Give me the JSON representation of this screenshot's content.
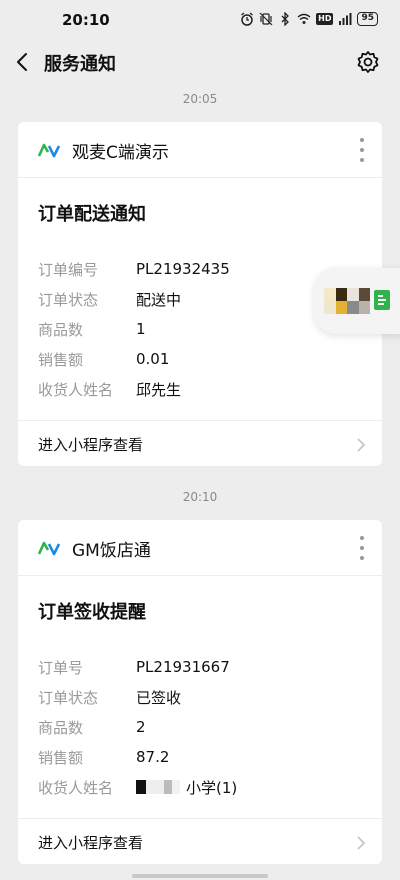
{
  "status_bar": {
    "time": "20:10",
    "battery": "95",
    "icons": [
      "alarm-icon",
      "vibrate-icon",
      "bluetooth-icon",
      "wifi-icon",
      "hd-icon",
      "signal-icon",
      "battery-icon"
    ],
    "hd_label": "HD"
  },
  "nav": {
    "title": "服务通知"
  },
  "messages": [
    {
      "timestamp": "20:05",
      "app_name": "观麦C端演示",
      "title": "订单配送通知",
      "fields": [
        {
          "label": "订单编号",
          "value": "PL21932435"
        },
        {
          "label": "订单状态",
          "value": "配送中"
        },
        {
          "label": "商品数",
          "value": "1"
        },
        {
          "label": "销售额",
          "value": "0.01"
        },
        {
          "label": "收货人姓名",
          "value": "邱先生"
        }
      ],
      "footer": "进入小程序查看"
    },
    {
      "timestamp": "20:10",
      "app_name": "GM饭店通",
      "title": "订单签收提醒",
      "fields": [
        {
          "label": "订单号",
          "value": "PL21931667"
        },
        {
          "label": "订单状态",
          "value": "已签收"
        },
        {
          "label": "商品数",
          "value": "2"
        },
        {
          "label": "销售额",
          "value": "87.2"
        },
        {
          "label": "收货人姓名",
          "value": "小学(1)"
        }
      ],
      "footer": "进入小程序查看"
    }
  ],
  "colors": {
    "background": "#ededed",
    "card": "#ffffff",
    "logo_green": "#2fb44a",
    "logo_blue": "#1e88e5",
    "label_gray": "#9a9a9a"
  }
}
